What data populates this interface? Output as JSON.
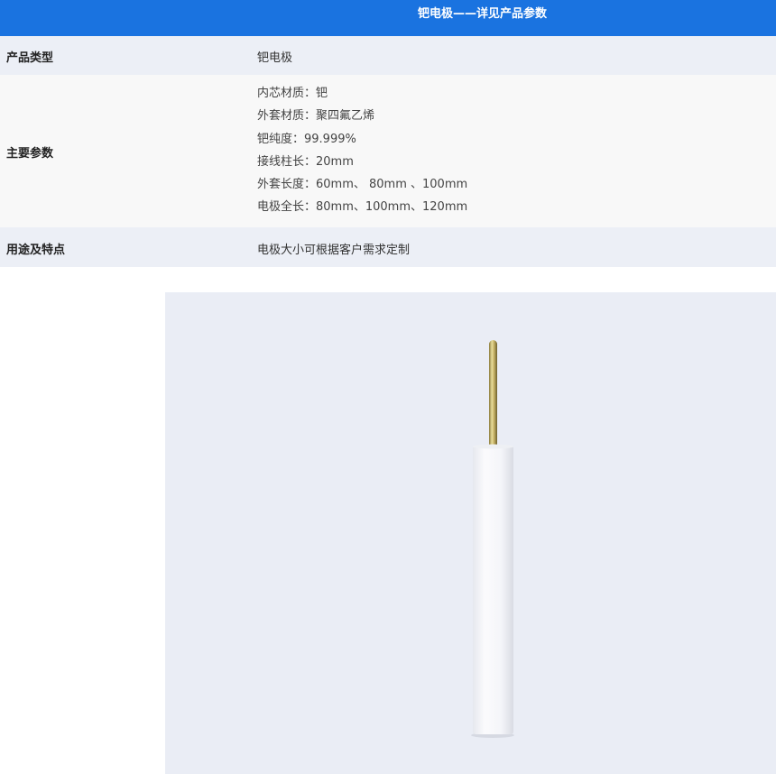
{
  "header": {
    "title": "钯电极——详见产品参数"
  },
  "rows": {
    "type": {
      "label": "产品类型",
      "value": "钯电极"
    },
    "params": {
      "label": "主要参数",
      "items": [
        "内芯材质：钯",
        "外套材质：聚四氟乙烯",
        "钯纯度：99.999%",
        "接线柱长：20mm",
        "外套长度：60mm、 80mm 、100mm",
        "电极全长：80mm、100mm、120mm"
      ]
    },
    "usage": {
      "label": "用途及特点",
      "value": "电极大小可根据客户需求定制"
    }
  },
  "colors": {
    "header_bg": "#1a73e0",
    "row_alt_bg": "#eceff6",
    "photo_bg": "#eaedf5"
  },
  "icons": {
    "product_photo": "palladium-electrode-photo"
  }
}
